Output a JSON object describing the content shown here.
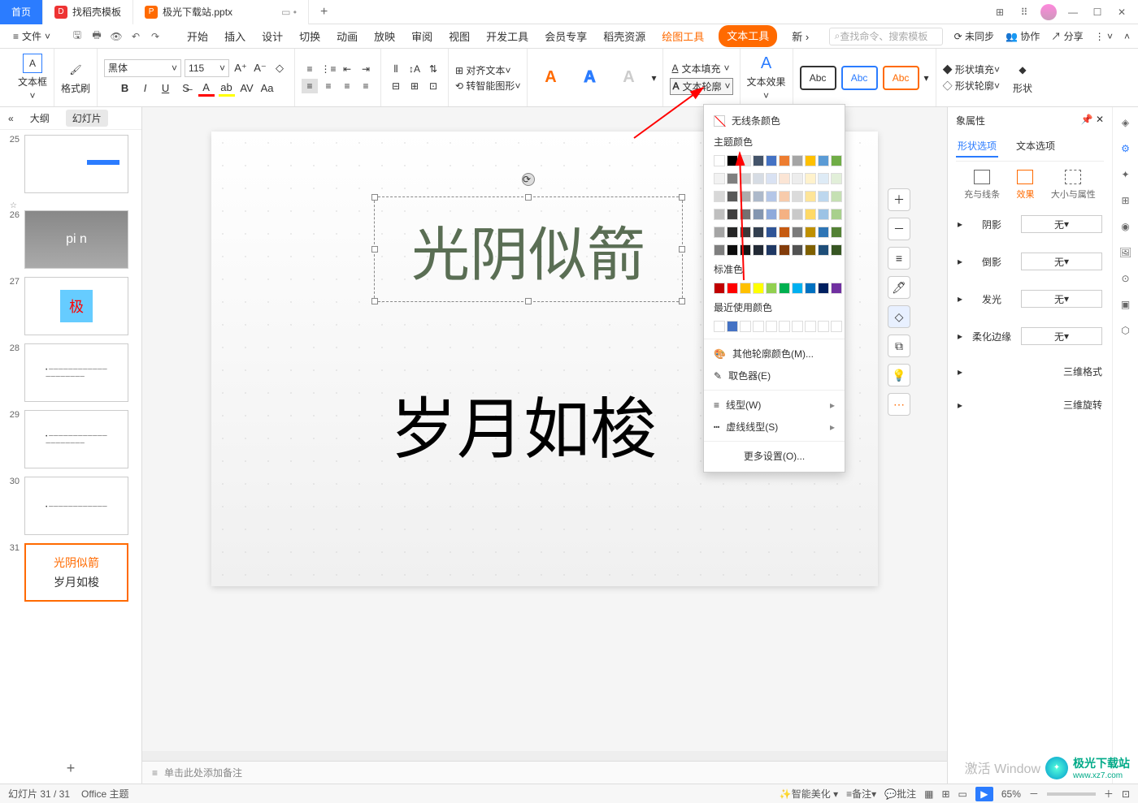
{
  "tabs": {
    "home": "首页",
    "template": "找稻壳模板",
    "file": "极光下载站.pptx"
  },
  "file_menu": "文件",
  "main_tabs": [
    "开始",
    "插入",
    "设计",
    "切换",
    "动画",
    "放映",
    "审阅",
    "视图",
    "开发工具",
    "会员专享",
    "稻壳资源"
  ],
  "draw_tool": "绘图工具",
  "text_tool": "文本工具",
  "new_tab": "新",
  "search_placeholder": "查找命令、搜索模板",
  "sync": "未同步",
  "coop": "协作",
  "share": "分享",
  "ribbon": {
    "textbox": "文本框",
    "format_brush": "格式刷",
    "font_name": "黑体",
    "font_size": "115",
    "align_text": "对齐文本",
    "smart_graphic": "转智能图形",
    "text_fill": "文本填充",
    "text_outline": "文本轮廓",
    "text_effect": "文本效果",
    "abc": "Abc",
    "shape_fill": "形状填充",
    "shape_outline": "形状轮廓",
    "shape_fx": "形状"
  },
  "left_panel": {
    "outline": "大纲",
    "slides": "幻灯片",
    "collapse": "«"
  },
  "thumbs": {
    "n25": "25",
    "n26": "26",
    "n27": "27",
    "n28": "28",
    "n29": "29",
    "n30": "30",
    "n31": "31",
    "t31a": "光阴似箭",
    "t31b": "岁月如梭",
    "pigeon": "pi    n",
    "ji": "极"
  },
  "canvas": {
    "text1": "光阴似箭",
    "text2": "岁月如梭"
  },
  "notes": "单击此处添加备注",
  "dropdown": {
    "no_line": "无线条颜色",
    "theme": "主题颜色",
    "standard": "标准色",
    "recent": "最近使用颜色",
    "more": "其他轮廓颜色(M)...",
    "eyedrop": "取色器(E)",
    "line_type": "线型(W)",
    "dash": "虚线线型(S)",
    "more_set": "更多设置(O)..."
  },
  "right_panel": {
    "title": "象属性",
    "shape_opt": "形状选项",
    "text_opt": "文本选项",
    "fill_line": "充与线条",
    "effects": "效果",
    "size_prop": "大小与属性",
    "shadow": "阴影",
    "reflect": "倒影",
    "glow": "发光",
    "soft": "柔化边缘",
    "threed": "三维格式",
    "rotate3d": "三维旋转",
    "none": "无"
  },
  "status": {
    "slide_count": "幻灯片 31 / 31",
    "theme": "Office 主题",
    "beautify": "智能美化",
    "notes_btn": "备注",
    "comment": "批注",
    "zoom": "65%"
  },
  "activate": "激活 Window",
  "watermark": "极光下载站",
  "watermark_url": "www.xz7.com",
  "colors": {
    "theme_row1": [
      "#ffffff",
      "#000000",
      "#e7e6e6",
      "#44546a",
      "#4472c4",
      "#ed7d31",
      "#a5a5a5",
      "#ffc000",
      "#5b9bd5",
      "#70ad47"
    ],
    "theme_shades": [
      [
        "#f2f2f2",
        "#7f7f7f",
        "#d0cece",
        "#d6dce4",
        "#d9e2f3",
        "#fbe5d5",
        "#ededed",
        "#fff2cc",
        "#deebf6",
        "#e2efd9"
      ],
      [
        "#d8d8d8",
        "#595959",
        "#aeabab",
        "#adb9ca",
        "#b4c6e7",
        "#f7cbac",
        "#dbdbdb",
        "#fee599",
        "#bdd7ee",
        "#c5e0b3"
      ],
      [
        "#bfbfbf",
        "#3f3f3f",
        "#757070",
        "#8496b0",
        "#8eaadb",
        "#f4b183",
        "#c9c9c9",
        "#ffd965",
        "#9cc3e5",
        "#a8d08d"
      ],
      [
        "#a5a5a5",
        "#262626",
        "#3a3838",
        "#323f4f",
        "#2f5496",
        "#c55a11",
        "#7b7b7b",
        "#bf9000",
        "#2e75b5",
        "#538135"
      ],
      [
        "#7f7f7f",
        "#0c0c0c",
        "#171616",
        "#222a35",
        "#1f3864",
        "#833c0b",
        "#525252",
        "#7f6000",
        "#1e4e79",
        "#375623"
      ]
    ],
    "standard": [
      "#c00000",
      "#ff0000",
      "#ffc000",
      "#ffff00",
      "#92d050",
      "#00b050",
      "#00b0f0",
      "#0070c0",
      "#002060",
      "#7030a0"
    ],
    "recent": [
      "#ffffff",
      "#4472c4",
      "#ffffff",
      "#ffffff",
      "#ffffff",
      "#ffffff",
      "#ffffff",
      "#ffffff",
      "#ffffff",
      "#ffffff"
    ]
  }
}
